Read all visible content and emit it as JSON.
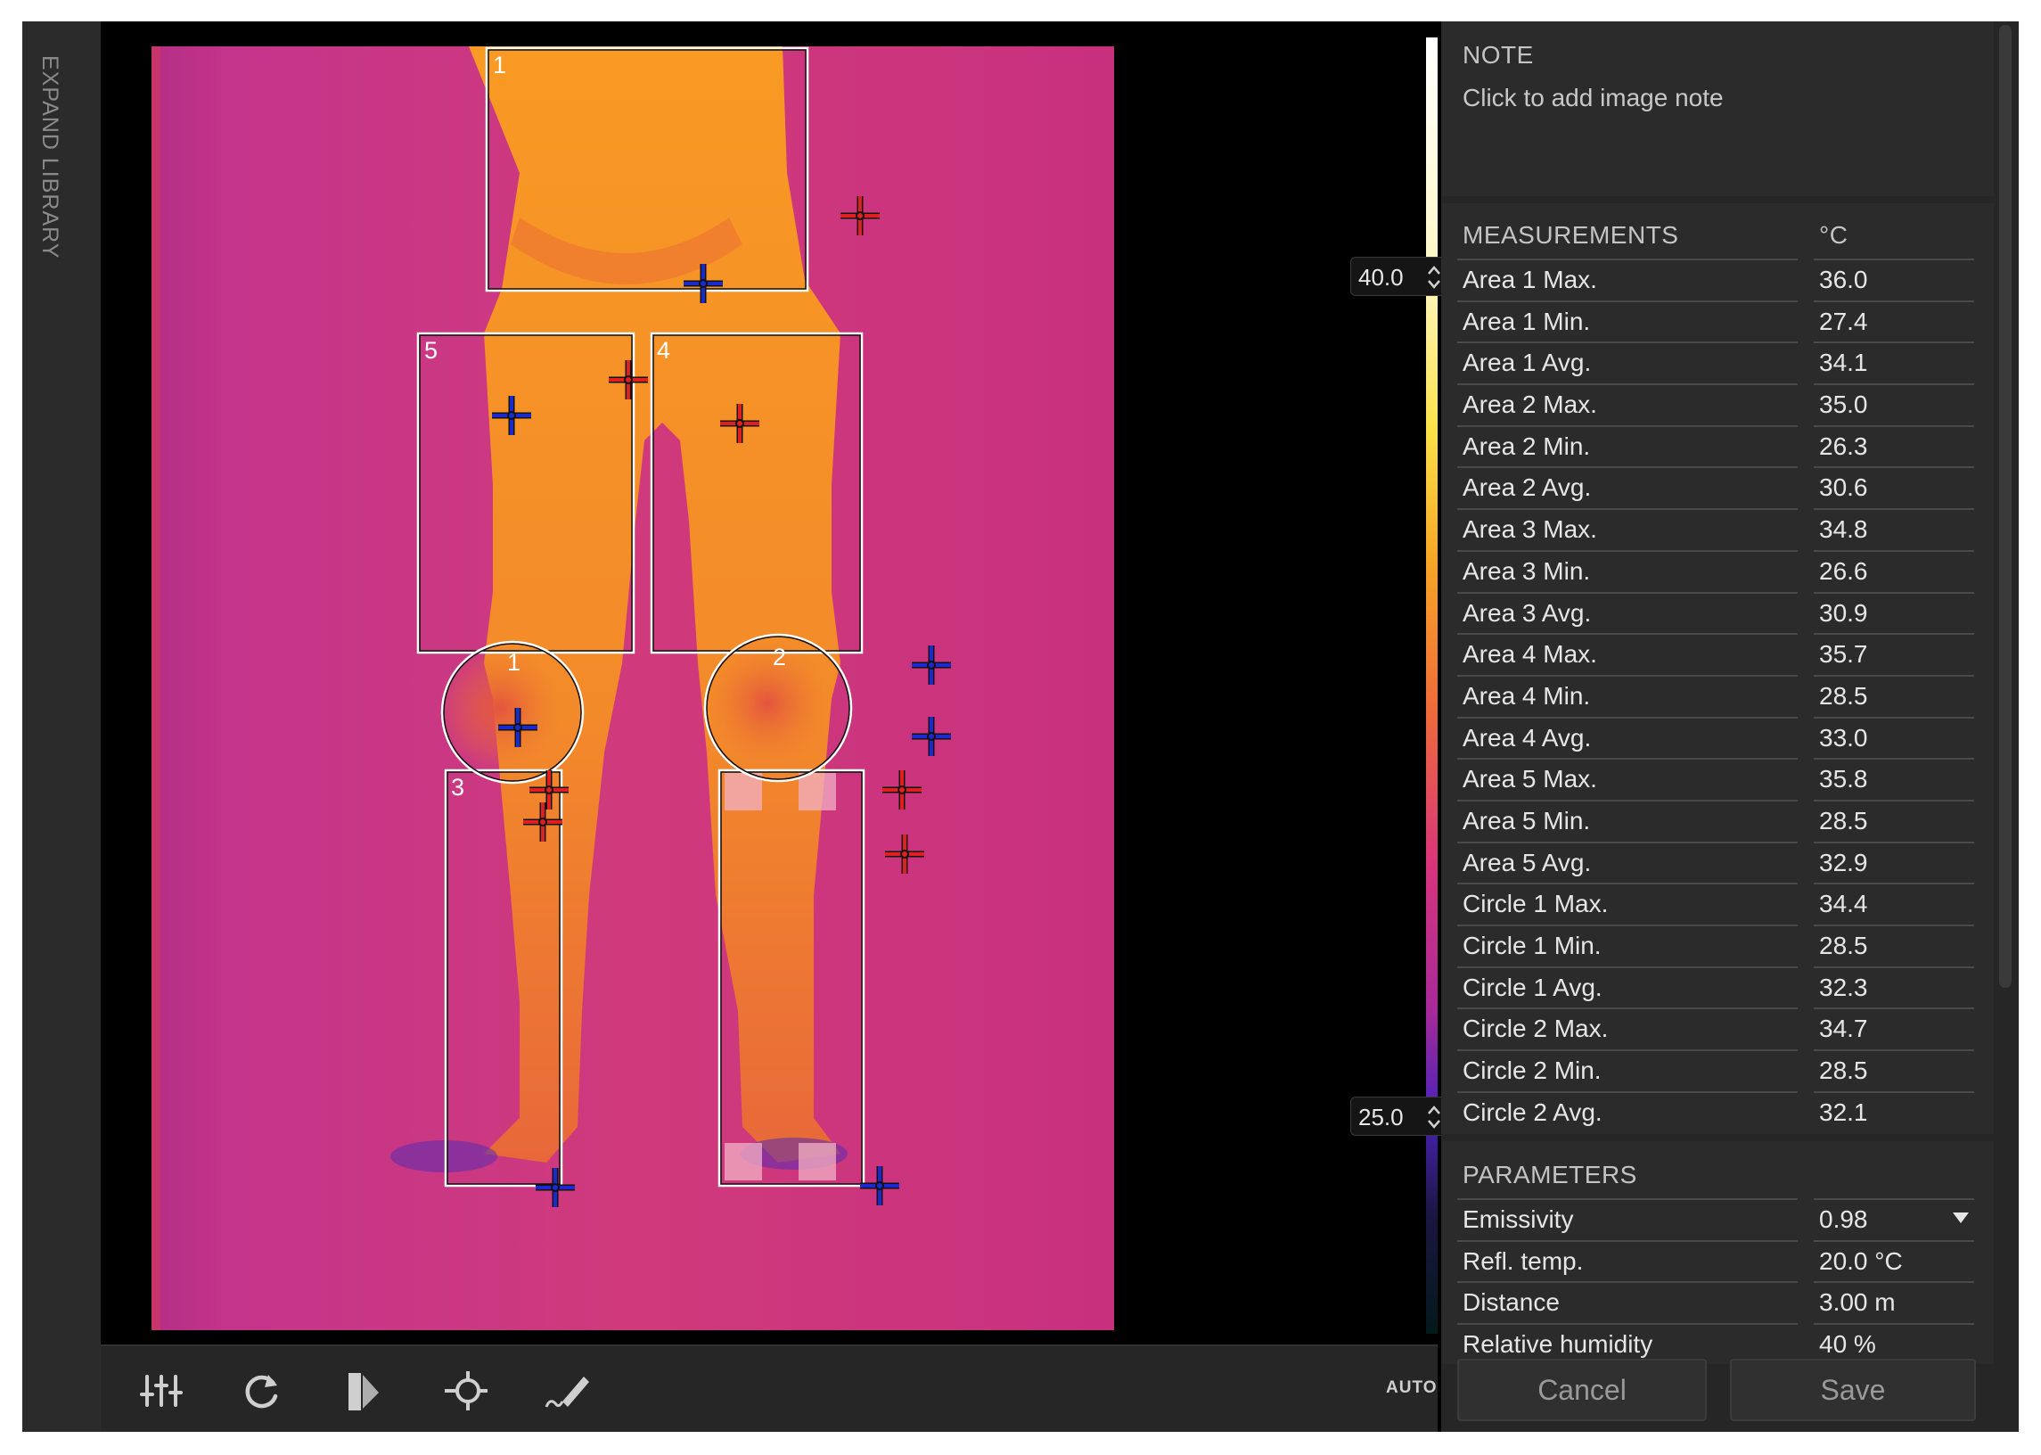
{
  "library": {
    "label": "EXPAND LIBRARY"
  },
  "scale": {
    "max": "40.0",
    "min": "25.0"
  },
  "toolbar": {
    "auto": "AUTO"
  },
  "note": {
    "title": "NOTE",
    "placeholder": "Click to add image note"
  },
  "measurements": {
    "title": "MEASUREMENTS",
    "unit": "°C",
    "rows": [
      {
        "label": "Area 1 Max.",
        "value": "36.0"
      },
      {
        "label": "Area 1 Min.",
        "value": "27.4"
      },
      {
        "label": "Area 1 Avg.",
        "value": "34.1"
      },
      {
        "label": "Area 2 Max.",
        "value": "35.0"
      },
      {
        "label": "Area 2 Min.",
        "value": "26.3"
      },
      {
        "label": "Area 2 Avg.",
        "value": "30.6"
      },
      {
        "label": "Area 3 Max.",
        "value": "34.8"
      },
      {
        "label": "Area 3 Min.",
        "value": "26.6"
      },
      {
        "label": "Area 3 Avg.",
        "value": "30.9"
      },
      {
        "label": "Area 4 Max.",
        "value": "35.7"
      },
      {
        "label": "Area 4 Min.",
        "value": "28.5"
      },
      {
        "label": "Area 4 Avg.",
        "value": "33.0"
      },
      {
        "label": "Area 5 Max.",
        "value": "35.8"
      },
      {
        "label": "Area 5 Min.",
        "value": "28.5"
      },
      {
        "label": "Area 5 Avg.",
        "value": "32.9"
      },
      {
        "label": "Circle 1 Max.",
        "value": "34.4"
      },
      {
        "label": "Circle 1 Min.",
        "value": "28.5"
      },
      {
        "label": "Circle 1 Avg.",
        "value": "32.3"
      },
      {
        "label": "Circle 2 Max.",
        "value": "34.7"
      },
      {
        "label": "Circle 2 Min.",
        "value": "28.5"
      },
      {
        "label": "Circle 2 Avg.",
        "value": "32.1"
      }
    ]
  },
  "parameters": {
    "title": "PARAMETERS",
    "rows": [
      {
        "label": "Emissivity",
        "value": "0.98"
      },
      {
        "label": "Refl. temp.",
        "value": "20.0 °C"
      },
      {
        "label": "Distance",
        "value": "3.00 m"
      },
      {
        "label": "Relative humidity",
        "value": "40 %"
      }
    ]
  },
  "actions": {
    "cancel": "Cancel",
    "save": "Save"
  },
  "overlays": {
    "area_labels": [
      "1",
      "5",
      "4",
      "3"
    ],
    "circle_labels": [
      "1",
      "2"
    ]
  },
  "colors": {
    "background_magenta": "#c8307e",
    "body_orange": "#f7941d",
    "hot_marker": "#e02020",
    "cold_marker": "#1a2ad0"
  }
}
